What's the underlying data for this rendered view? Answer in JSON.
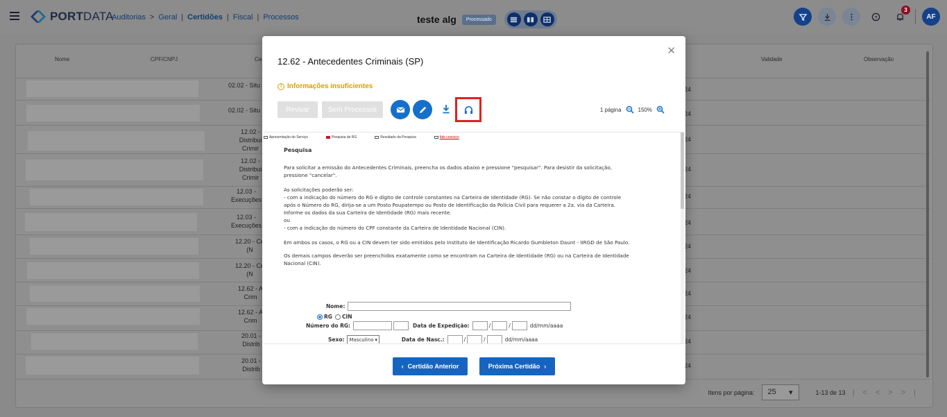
{
  "header": {
    "logo": {
      "bold": "PORT",
      "light": "DATA"
    },
    "breadcrumb": [
      {
        "label": "Auditorias",
        "active": false
      },
      {
        "label": "Geral",
        "active": false
      },
      {
        "label": "Certidões",
        "active": true
      },
      {
        "label": "Fiscal",
        "active": false
      },
      {
        "label": "Processos",
        "active": false
      }
    ],
    "title": "teste alg",
    "status_badge": "Processado",
    "notification_count": "3",
    "avatar_initials": "AF"
  },
  "table": {
    "columns": [
      "Nome",
      "CPF/CNPJ",
      "Cer",
      "Validade",
      "Observação"
    ],
    "rows": [
      {
        "code": "02.02 - Situ",
        "code2": "",
        "suffix": "24"
      },
      {
        "code": "02.02 - Situ",
        "code2": "",
        "suffix": "24"
      },
      {
        "code": "12.02 -",
        "code2": "Distribui",
        "code3": "Crimir",
        "suffix": "24"
      },
      {
        "code": "12.02 -",
        "code2": "Distribui",
        "code3": "Crimir",
        "suffix": "24"
      },
      {
        "code": "12.03 -",
        "code2": "Execuções",
        "suffix": "24"
      },
      {
        "code": "12.03 -",
        "code2": "Execuções",
        "suffix": "24"
      },
      {
        "code": "12.20 - Ce",
        "code2": "(N",
        "suffix": "24"
      },
      {
        "code": "12.20 - Ce",
        "code2": "(N",
        "suffix": "24"
      },
      {
        "code": "12.62 - A",
        "code2": "Crim",
        "suffix": "24"
      },
      {
        "code": "12.62 - A",
        "code2": "Crim",
        "suffix": "24"
      },
      {
        "code": "20.01 -",
        "code2": "Distrib",
        "suffix": "24"
      },
      {
        "code": "20.01 -",
        "code2": "Distrib",
        "suffix": "24"
      }
    ],
    "pager": {
      "items_per_page_label": "Itens por página:",
      "items_per_page": "25",
      "range": "1-13 de 13"
    }
  },
  "modal": {
    "title": "12.62 - Antecedentes Criminais (SP)",
    "warning": "Informações insuficientes",
    "btn_revisar": "Revisar",
    "btn_sem_processos": "Sem Processos",
    "pages": "1 página",
    "zoom": "150%",
    "prev_button": "Certidão Anterior",
    "next_button": "Próxima Certidão",
    "doc": {
      "tabs": [
        "Apresentação do Serviço",
        "Pesquisa de RG",
        "Resultado da Pesquisa",
        "fale conosco"
      ],
      "heading": "Pesquisa",
      "p1": "Para solicitar a emissão do Antecedentes Criminais, preencha os dados abaixo e pressione \"pesquisar\". Para desistir da solicitação, pressione \"cancelar\".",
      "p2_intro": "As solicitações poderão ser:",
      "p2_a": "- com a indicação do número do RG e dígito de controle constantes na Carteira de Identidade (RG). Se não constar o dígito de controle após o Número do RG, dirija-se a um Posto Poupatempo ou Posto de Identificação da Polícia Civil para requerer a 2a. via da Carteira. Informe os dados da sua Carteira de Identidade (RG) mais recente.",
      "p2_ou": "ou",
      "p2_b": "- com a indicação do número do CPF constante da Carteira de Identidade Nacional (CIN).",
      "p3": "Em ambos os casos, o RG ou a CIN devem ter sido emitidos pelo Instituto de Identificação Ricardo Gumbleton Daunt - IIRGD de São Paulo.",
      "p4": "Os demais campos deverão ser preenchidos exatamente como se encontram na Carteira de Identidade (RG) ou na Carteira de Identidade Nacional (CIN).",
      "label_nome": "Nome:",
      "label_rg": "RG",
      "label_cin": "CIN",
      "label_numero_rg": "Número do RG:",
      "label_data_exp": "Data de Expedição:",
      "label_sexo": "Sexo:",
      "sexo_value": "Masculino",
      "label_data_nasc": "Data de Nasc.:",
      "date_hint": "dd/mm/aaaa",
      "date_sep": "/"
    }
  },
  "colors": {
    "primary": "#1565c0",
    "warning": "#d4a000",
    "highlight_border": "#e02020"
  }
}
